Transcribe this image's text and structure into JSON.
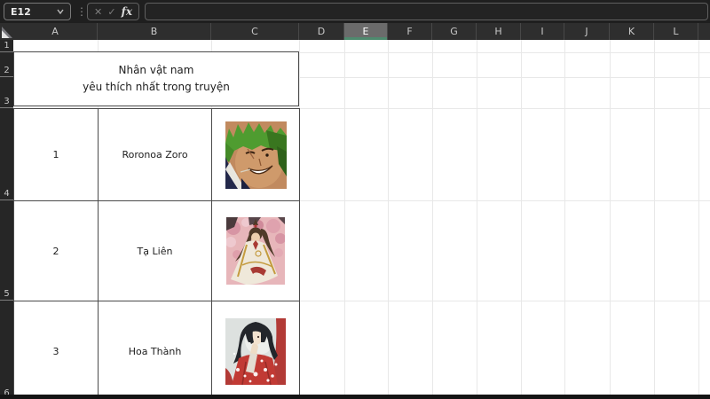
{
  "formula_bar": {
    "name_box_value": "E12",
    "formula_value": ""
  },
  "icons": {
    "cancel": "✕",
    "enter": "✓",
    "function": "fx",
    "more_options": "⋮"
  },
  "grid": {
    "column_headers": [
      "A",
      "B",
      "C",
      "D",
      "E",
      "F",
      "G",
      "H",
      "I",
      "J",
      "K",
      "L"
    ],
    "selected_column": "E",
    "row_headers": [
      "1",
      "2",
      "3",
      "4",
      "5",
      "6"
    ],
    "colors": {
      "selection_accent": "#4e8a6e",
      "header_bg": "#2e2e2e",
      "selected_header_bg": "#6b6b6b",
      "gridline": "#e8e8e8"
    }
  },
  "table": {
    "title": "Nhân vật nam\nyêu thích nhất trong truyện",
    "rows": [
      {
        "rank": "1",
        "name": "Roronoa Zoro",
        "image": "roronoa-zoro-portrait"
      },
      {
        "rank": "2",
        "name": "Tạ Liên",
        "image": "ta-lien-portrait"
      },
      {
        "rank": "3",
        "name": "Hoa Thành",
        "image": "hoa-thanh-portrait"
      }
    ]
  }
}
